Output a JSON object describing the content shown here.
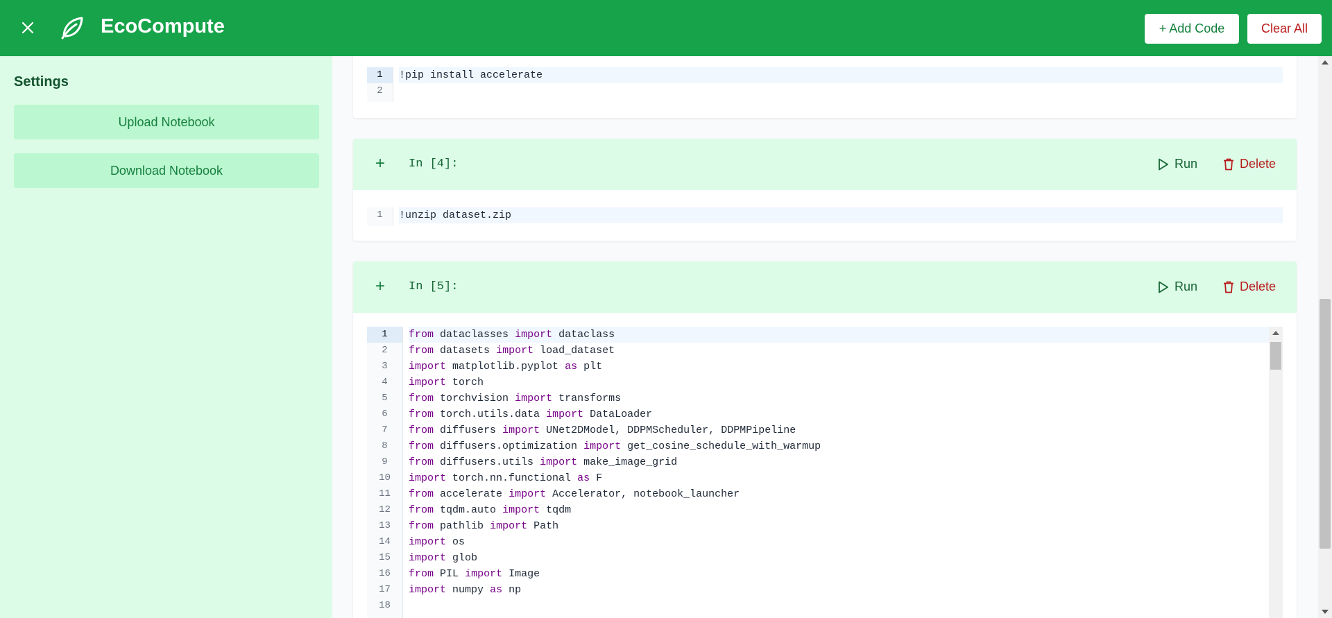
{
  "header": {
    "brand": "EcoCompute",
    "add_code_label": "+ Add Code",
    "clear_all_label": "Clear All",
    "close_icon": "close-icon",
    "logo_icon": "leaf-icon"
  },
  "sidebar": {
    "title": "Settings",
    "upload_label": "Upload Notebook",
    "download_label": "Download Notebook"
  },
  "colors": {
    "primary": "#16a34a",
    "sidebar_bg": "#dcfce7",
    "button_bg": "#bbf7d0",
    "danger": "#b91c1c"
  },
  "cells": [
    {
      "lines": [
        "1",
        "2"
      ],
      "code": [
        "!pip install accelerate",
        ""
      ]
    },
    {
      "prompt": "In [4]:",
      "run_label": "Run",
      "delete_label": "Delete",
      "add_label": "+",
      "lines": [
        "1"
      ],
      "code": [
        "!unzip dataset.zip"
      ]
    },
    {
      "prompt": "In [5]:",
      "run_label": "Run",
      "delete_label": "Delete",
      "add_label": "+",
      "lines": [
        "1",
        "2",
        "3",
        "4",
        "5",
        "6",
        "7",
        "8",
        "9",
        "10",
        "11",
        "12",
        "13",
        "14",
        "15",
        "16",
        "17",
        "18"
      ],
      "code": [
        "from dataclasses import dataclass",
        "from datasets import load_dataset",
        "import matplotlib.pyplot as plt",
        "import torch",
        "from torchvision import transforms",
        "from torch.utils.data import DataLoader",
        "from diffusers import UNet2DModel, DDPMScheduler, DDPMPipeline",
        "from diffusers.optimization import get_cosine_schedule_with_warmup",
        "from diffusers.utils import make_image_grid",
        "import torch.nn.functional as F",
        "from accelerate import Accelerator, notebook_launcher",
        "from tqdm.auto import tqdm",
        "from pathlib import Path",
        "import os",
        "import glob",
        "from PIL import Image",
        "import numpy as np",
        ""
      ]
    }
  ]
}
